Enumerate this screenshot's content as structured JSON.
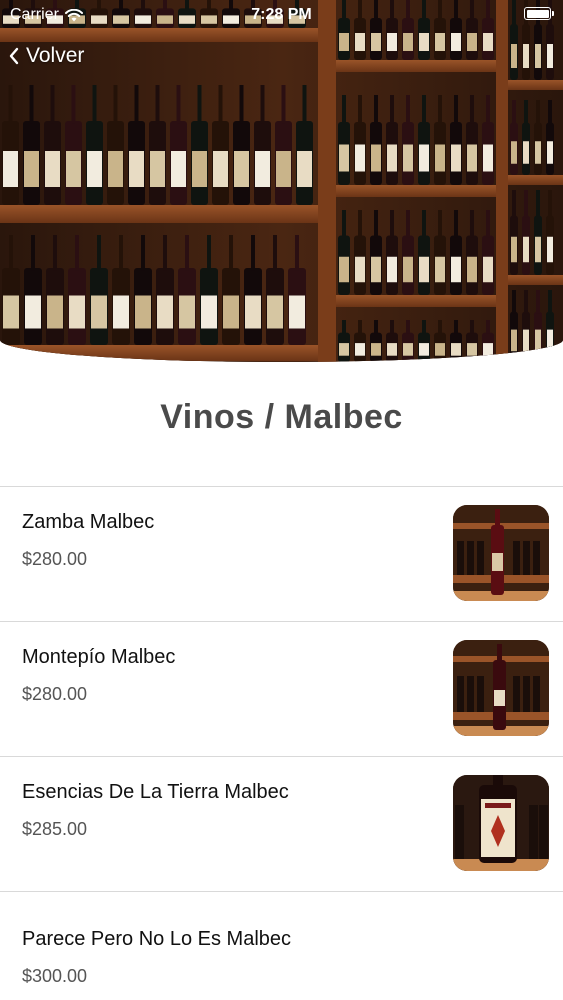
{
  "status_bar": {
    "carrier": "Carrier",
    "time": "7:28 PM"
  },
  "nav": {
    "back_label": "Volver"
  },
  "page": {
    "title": "Vinos / Malbec"
  },
  "products": [
    {
      "name": "Zamba Malbec",
      "price": "$280.00"
    },
    {
      "name": "Montepío Malbec",
      "price": "$280.00"
    },
    {
      "name": "Esencias De La Tierra Malbec",
      "price": "$285.00"
    },
    {
      "name": "Parece Pero No Lo Es Malbec",
      "price": "$300.00"
    }
  ],
  "colors": {
    "title": "#4a4a4a",
    "shelf_wood": "#8b4a22",
    "divider": "#d9d9d9"
  }
}
